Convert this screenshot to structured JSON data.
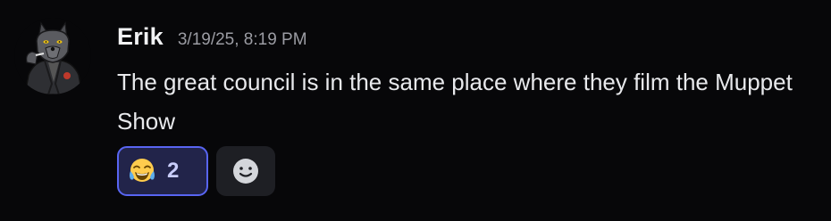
{
  "message": {
    "author": "Erik",
    "timestamp": "3/19/25, 8:19 PM",
    "text": "The great council is in the same place where they film the Muppet Show"
  },
  "reactions": [
    {
      "emoji": "tears-of-joy-icon",
      "count": "2",
      "active": true
    }
  ],
  "add_reaction": {
    "icon": "smiley-add-reaction-icon"
  },
  "colors": {
    "background": "#070709",
    "accent": "#5865f2",
    "reaction_active_bg": "#22244a",
    "username": "#f2f3f5",
    "timestamp": "#9b9ca3"
  }
}
